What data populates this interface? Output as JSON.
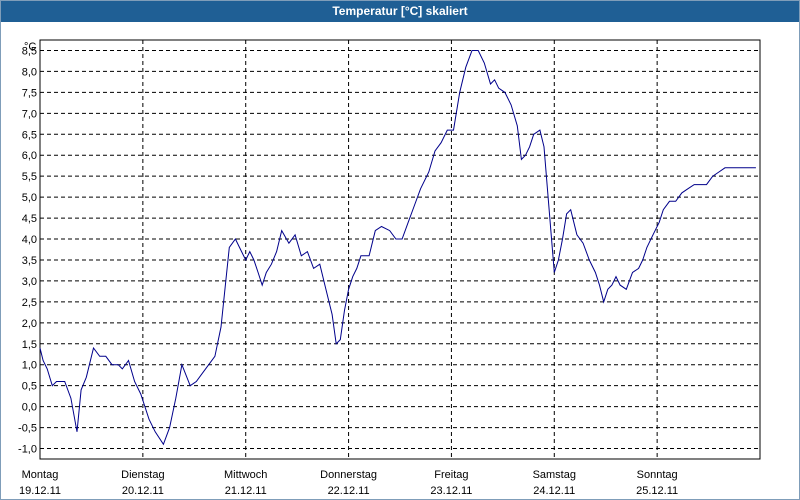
{
  "window": {
    "title": "Temperatur [°C] skaliert"
  },
  "chart_data": {
    "type": "line",
    "title": "Temperatur [°C] skaliert",
    "ylabel": "°C",
    "xlabel": "",
    "ylim": [
      -1.25,
      8.75
    ],
    "y_ticks": [
      "8,5",
      "8,0",
      "7,5",
      "7,0",
      "6,5",
      "6,0",
      "5,5",
      "5,0",
      "4,5",
      "4,0",
      "3,5",
      "3,0",
      "2,5",
      "2,0",
      "1,5",
      "1,0",
      "0,5",
      "0,0",
      "-0,5",
      "-1,0"
    ],
    "xlim": [
      0,
      7
    ],
    "x_ticks": [
      {
        "day": "Montag",
        "date": "19.12.11"
      },
      {
        "day": "Dienstag",
        "date": "20.12.11"
      },
      {
        "day": "Mittwoch",
        "date": "21.12.11"
      },
      {
        "day": "Donnerstag",
        "date": "22.12.11"
      },
      {
        "day": "Freitag",
        "date": "23.12.11"
      },
      {
        "day": "Samstag",
        "date": "24.12.11"
      },
      {
        "day": "Sonntag",
        "date": "25.12.11"
      }
    ],
    "grid": true,
    "series": [
      {
        "color": "#00008b",
        "x": [
          0,
          0.03,
          0.07,
          0.12,
          0.16,
          0.24,
          0.3,
          0.36,
          0.4,
          0.45,
          0.52,
          0.58,
          0.64,
          0.7,
          0.76,
          0.8,
          0.86,
          0.92,
          0.98,
          1.02,
          1.06,
          1.12,
          1.2,
          1.26,
          1.32,
          1.38,
          1.46,
          1.52,
          1.58,
          1.64,
          1.7,
          1.76,
          1.84,
          1.9,
          1.94,
          2.0,
          2.04,
          2.08,
          2.12,
          2.16,
          2.2,
          2.25,
          2.3,
          2.35,
          2.42,
          2.48,
          2.54,
          2.6,
          2.66,
          2.72,
          2.78,
          2.84,
          2.88,
          2.92,
          2.96,
          3.0,
          3.04,
          3.08,
          3.12,
          3.16,
          3.2,
          3.26,
          3.32,
          3.4,
          3.46,
          3.52,
          3.58,
          3.64,
          3.7,
          3.78,
          3.84,
          3.9,
          3.96,
          4.02,
          4.08,
          4.14,
          4.2,
          4.26,
          4.32,
          4.38,
          4.42,
          4.46,
          4.52,
          4.58,
          4.64,
          4.68,
          4.72,
          4.76,
          4.8,
          4.86,
          4.9,
          4.94,
          5.0,
          5.04,
          5.08,
          5.12,
          5.16,
          5.22,
          5.28,
          5.34,
          5.4,
          5.44,
          5.48,
          5.52,
          5.56,
          5.6,
          5.64,
          5.7,
          5.76,
          5.82,
          5.86,
          5.9,
          5.96,
          6.02,
          6.06,
          6.12,
          6.18,
          6.24,
          6.3,
          6.36,
          6.42,
          6.48,
          6.54,
          6.6,
          6.66,
          6.72,
          6.78,
          6.84,
          6.9,
          6.96
        ],
        "y": [
          1.4,
          1.1,
          0.9,
          0.5,
          0.6,
          0.6,
          0.2,
          -0.6,
          0.4,
          0.7,
          1.4,
          1.2,
          1.2,
          1.0,
          1.0,
          0.9,
          1.1,
          0.6,
          0.3,
          0.0,
          -0.3,
          -0.6,
          -0.9,
          -0.5,
          0.2,
          1.0,
          0.5,
          0.6,
          0.8,
          1.0,
          1.2,
          1.9,
          3.8,
          4.0,
          3.8,
          3.5,
          3.7,
          3.5,
          3.2,
          2.9,
          3.2,
          3.4,
          3.7,
          4.2,
          3.9,
          4.1,
          3.6,
          3.7,
          3.3,
          3.4,
          2.8,
          2.2,
          1.5,
          1.6,
          2.3,
          2.8,
          3.1,
          3.3,
          3.6,
          3.6,
          3.6,
          4.2,
          4.3,
          4.2,
          4.0,
          4.0,
          4.4,
          4.8,
          5.2,
          5.6,
          6.1,
          6.3,
          6.6,
          6.6,
          7.5,
          8.1,
          8.5,
          8.5,
          8.2,
          7.7,
          7.8,
          7.6,
          7.5,
          7.2,
          6.7,
          5.9,
          6.0,
          6.2,
          6.5,
          6.6,
          6.2,
          5.0,
          3.2,
          3.5,
          4.0,
          4.6,
          4.7,
          4.1,
          3.9,
          3.5,
          3.2,
          2.9,
          2.5,
          2.8,
          2.9,
          3.1,
          2.9,
          2.8,
          3.2,
          3.3,
          3.5,
          3.8,
          4.1,
          4.4,
          4.7,
          4.9,
          4.9,
          5.1,
          5.2,
          5.3,
          5.3,
          5.3,
          5.5,
          5.6,
          5.7,
          5.7,
          5.7,
          5.7,
          5.7,
          5.7
        ]
      }
    ]
  }
}
